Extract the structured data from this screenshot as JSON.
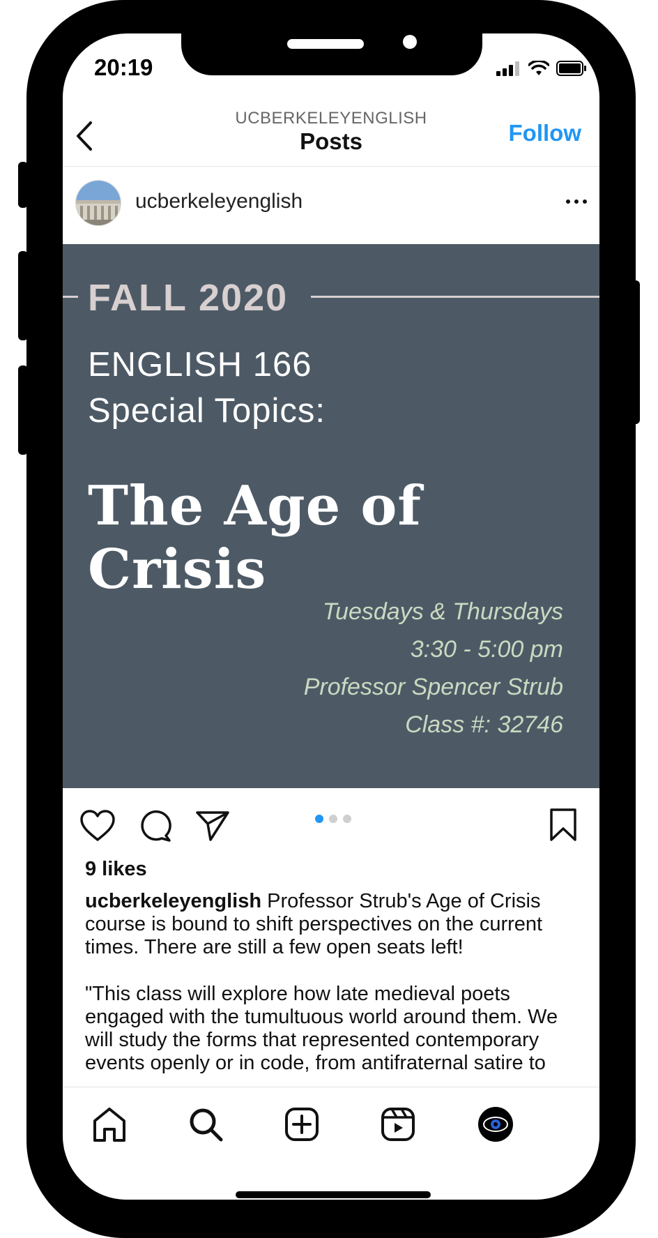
{
  "status": {
    "time": "20:19"
  },
  "header": {
    "account": "UCBERKELEYENGLISH",
    "title": "Posts",
    "follow_label": "Follow"
  },
  "post": {
    "username": "ucberkeleyenglish",
    "image": {
      "season": "FALL 2020",
      "course_line1": "ENGLISH 166",
      "course_line2": "Special Topics:",
      "course_title": "The Age of Crisis",
      "days": "Tuesdays & Thursdays",
      "time": "3:30 - 5:00 pm",
      "professor": "Professor Spencer Strub",
      "class_number": "Class #: 32746"
    },
    "carousel": {
      "count": 3,
      "active": 1
    },
    "likes": "9 likes",
    "caption_user": "ucberkeleyenglish",
    "caption_text": "Professor Strub's Age of Crisis course is bound to shift perspectives on the current times. There are still a few open seats left!",
    "caption_quote": "\"This class will explore how late medieval poets engaged with the tumultuous world around them. We will study the forms that represented contemporary events openly or in code, from antifraternal satire to"
  },
  "icons": [
    "chevron-left-icon",
    "more-icon",
    "heart-icon",
    "comment-icon",
    "share-icon",
    "bookmark-icon",
    "home-icon",
    "search-icon",
    "new-post-icon",
    "reels-icon",
    "profile-icon"
  ],
  "colors": {
    "accent": "#2196f3",
    "image_bg": "#4d5a66",
    "season": "#d8cfd0",
    "details": "#cbd9c1"
  }
}
